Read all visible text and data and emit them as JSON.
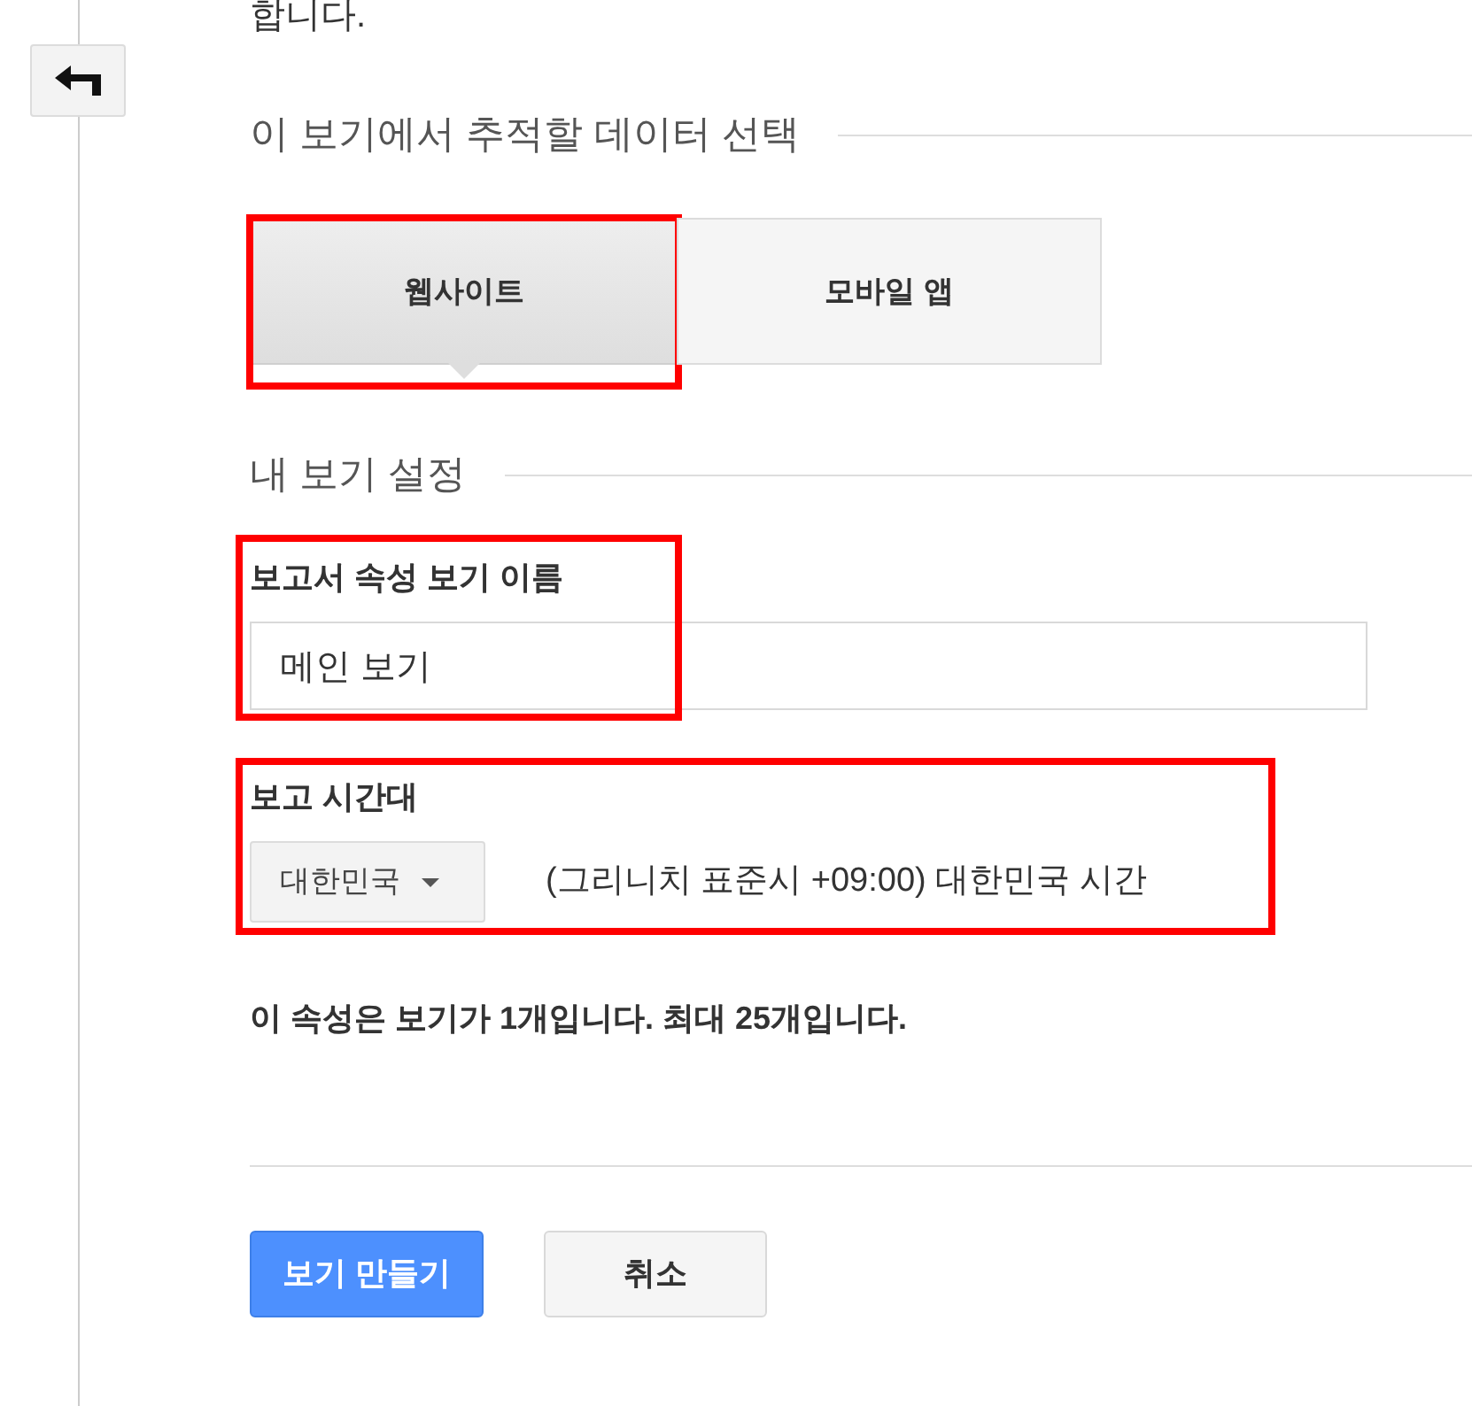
{
  "intro_text": "합니다.",
  "tracking_section": {
    "heading": "이 보기에서 추적할 데이터 선택",
    "highlighted": true,
    "options": [
      {
        "label": "웹사이트",
        "selected": true
      },
      {
        "label": "모바일 앱",
        "selected": false
      }
    ]
  },
  "settings_section": {
    "heading": "내 보기 설정"
  },
  "view_name": {
    "label": "보고서 속성 보기 이름",
    "value": "메인 보기",
    "highlighted": true
  },
  "timezone": {
    "label": "보고 시간대",
    "country": "대한민국",
    "zone": "(그리니치 표준시 +09:00) 대한민국 시간",
    "highlighted": true
  },
  "note": "이 속성은 보기가 1개입니다. 최대 25개입니다.",
  "buttons": [
    {
      "label": "보기 만들기",
      "kind": "primary"
    },
    {
      "label": "취소",
      "kind": "secondary"
    }
  ]
}
